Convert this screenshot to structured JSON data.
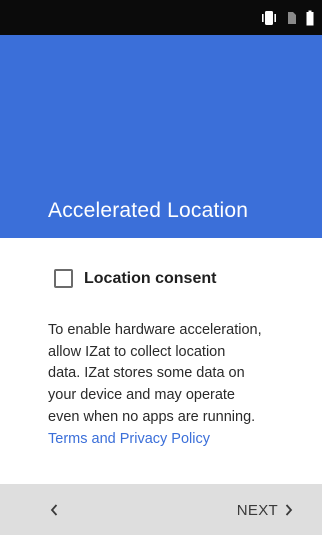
{
  "colors": {
    "status_bar": "#0b0b0b",
    "header": "#3b6fd9",
    "link": "#3b6fd9",
    "bottom_bar": "#dedede"
  },
  "status_bar": {
    "icons": [
      "vibrate-icon",
      "no-sim-icon",
      "battery-icon"
    ]
  },
  "header": {
    "title": "Accelerated Location"
  },
  "consent": {
    "label": "Location consent",
    "checked": false
  },
  "description": {
    "lines": [
      "To enable hardware acceleration,",
      "allow IZat to collect location",
      "data. IZat stores some data on",
      "your device and may operate",
      "even when no apps are running."
    ],
    "link": "Terms and Privacy Policy"
  },
  "nav": {
    "back_icon": "chevron-left-icon",
    "next_label": "NEXT",
    "next_icon": "chevron-right-icon"
  }
}
